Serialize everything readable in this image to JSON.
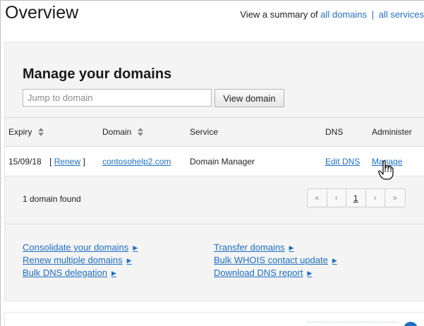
{
  "header": {
    "title": "Overview",
    "summary_prefix": "View a summary of",
    "link_all_domains": "all domains",
    "separator": "|",
    "link_all_services": "all services"
  },
  "manage": {
    "title": "Manage your domains",
    "search_placeholder": "Jump to domain",
    "view_button": "View domain"
  },
  "table": {
    "columns": {
      "expiry": "Expiry",
      "domain": "Domain",
      "service": "Service",
      "dns": "DNS",
      "administer": "Administer"
    },
    "rows": [
      {
        "expiry": "15/09/18",
        "renew_open": "[",
        "renew": "Renew",
        "renew_close": "]",
        "domain": "contosohelp2.com",
        "service": "Domain Manager",
        "dns": "Edit DNS",
        "administer": "Manage"
      }
    ]
  },
  "results": {
    "count_text": "1 domain found"
  },
  "pagination": {
    "first": "«",
    "prev": "‹",
    "current": "1",
    "next": "›",
    "last": "»"
  },
  "actions": {
    "consolidate": "Consolidate your domains",
    "renew_multiple": "Renew multiple domains",
    "bulk_dns": "Bulk DNS delegation",
    "transfer": "Transfer domains",
    "bulk_whois": "Bulk WHOIS contact update",
    "download_dns": "Download DNS report",
    "arrow_glyph": "▶"
  },
  "icons": {
    "sort": "sort-icon",
    "cursor": "hand-pointer-icon"
  },
  "colors": {
    "link": "#1f6fc5",
    "panel_bg": "#f4f4f4"
  }
}
